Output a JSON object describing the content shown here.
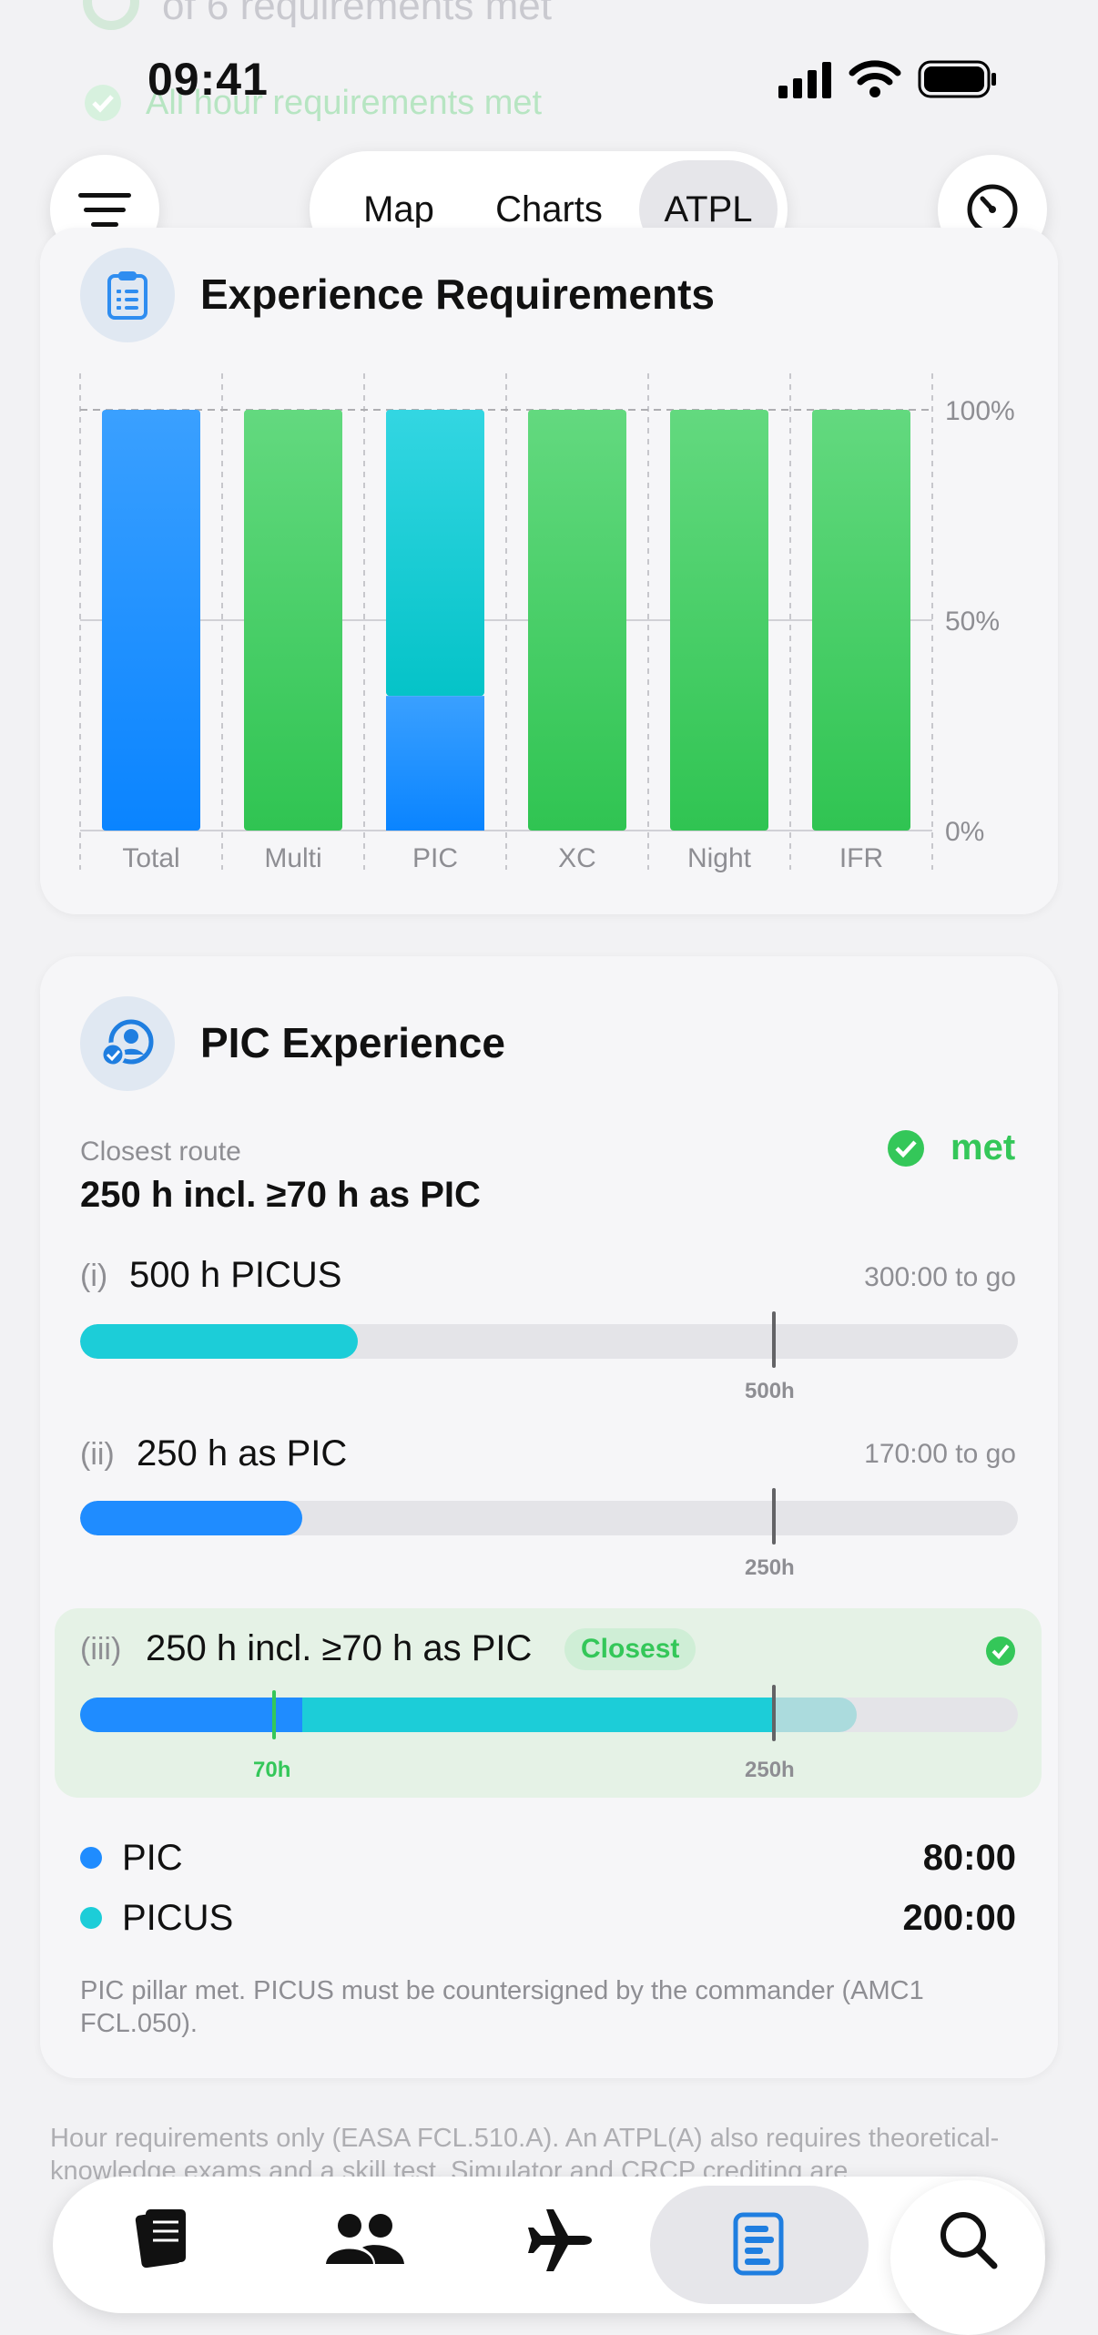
{
  "status": {
    "time": "09:41"
  },
  "ghost": {
    "summary": "of 6 requirements met",
    "hours_met": "All hour requirements met"
  },
  "nav": {
    "tabs": [
      "Map",
      "Charts",
      "ATPL"
    ],
    "active": "ATPL"
  },
  "requirements_card": {
    "title": "Experience Requirements",
    "chart_data": {
      "type": "bar",
      "categories": [
        "Total",
        "Multi",
        "PIC",
        "XC",
        "Night",
        "IFR"
      ],
      "series": [
        {
          "values": [
            100,
            100,
            100,
            100,
            100,
            100
          ]
        }
      ],
      "pic_stack": {
        "pic": 32,
        "picus": 68
      },
      "ylim": [
        0,
        100
      ],
      "yticks": [
        "0%",
        "50%",
        "100%"
      ],
      "colors": {
        "Total": "#1f8cff",
        "Multi": "#3ccf62",
        "PIC": "#1ccdd8",
        "XC": "#3ccf62",
        "Night": "#3ccf62",
        "IFR": "#3ccf62"
      }
    }
  },
  "pic_card": {
    "title": "PIC Experience",
    "closest_label": "Closest route",
    "closest_value": "250 h incl. ≥70 h as PIC",
    "met_label": "met",
    "routes": [
      {
        "roman": "(i)",
        "name": "500 h PICUS",
        "remaining": "300:00 to go",
        "target_label": "500h",
        "progress": 0.4
      },
      {
        "roman": "(ii)",
        "name": "250 h as PIC",
        "remaining": "170:00 to go",
        "target_label": "250h",
        "progress": 0.32
      },
      {
        "roman": "(iii)",
        "name": "250 h incl. ≥70 h as PIC",
        "badge": "Closest",
        "min_label": "70h",
        "target_label": "250h",
        "pic_fraction": 0.32,
        "picus_fraction": 0.8,
        "total_fraction": 1.12
      }
    ],
    "legend": [
      {
        "label": "PIC",
        "value": "80:00",
        "color": "#1f8cff"
      },
      {
        "label": "PICUS",
        "value": "200:00",
        "color": "#1ccdd8"
      }
    ],
    "note": "PIC pillar met. PICUS must be countersigned by the commander (AMC1 FCL.050)."
  },
  "footer_note": "Hour requirements only (EASA FCL.510.A). An ATPL(A) also requires theoretical-knowledge exams and a skill test. Simulator and CRCP crediting are",
  "tabbar": {
    "items": [
      "logbook-icon",
      "crew-icon",
      "aircraft-icon",
      "reports-icon"
    ],
    "active": "reports-icon"
  }
}
